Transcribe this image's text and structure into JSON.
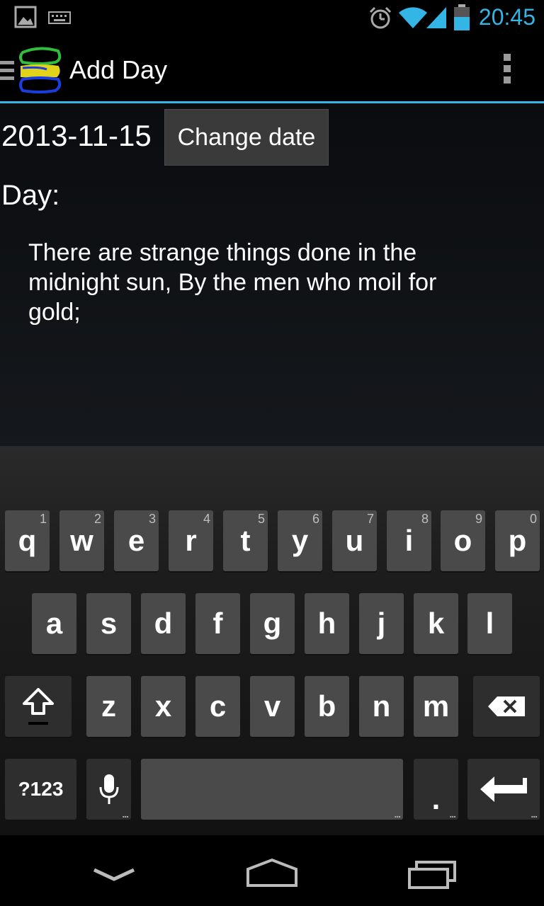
{
  "status_bar": {
    "time": "20:45",
    "icons": [
      "image-icon",
      "keyboard-icon",
      "alarm-icon",
      "wifi-icon",
      "signal-icon",
      "battery-icon"
    ],
    "accent": "#33b5e5"
  },
  "action_bar": {
    "title": "Add Day",
    "app_icon": "app-logo-icon",
    "menu_icon": "drawer-icon",
    "overflow_icon": "overflow-menu-icon"
  },
  "form": {
    "date": "2013-11-15",
    "change_date_label": "Change date",
    "day_label": "Day:",
    "day_text": "There are strange things done in the midnight sun, By the men who moil for gold;"
  },
  "keyboard": {
    "row1": [
      {
        "key": "q",
        "hint": "1"
      },
      {
        "key": "w",
        "hint": "2"
      },
      {
        "key": "e",
        "hint": "3"
      },
      {
        "key": "r",
        "hint": "4"
      },
      {
        "key": "t",
        "hint": "5"
      },
      {
        "key": "y",
        "hint": "6"
      },
      {
        "key": "u",
        "hint": "7"
      },
      {
        "key": "i",
        "hint": "8"
      },
      {
        "key": "o",
        "hint": "9"
      },
      {
        "key": "p",
        "hint": "0"
      }
    ],
    "row2": [
      "a",
      "s",
      "d",
      "f",
      "g",
      "h",
      "j",
      "k",
      "l"
    ],
    "row3": [
      "z",
      "x",
      "c",
      "v",
      "b",
      "n",
      "m"
    ],
    "symbols_label": "?123",
    "period_label": ".",
    "shift_icon": "shift-icon",
    "backspace_icon": "backspace-icon",
    "mic_icon": "microphone-icon",
    "enter_icon": "enter-icon"
  },
  "nav_bar": {
    "icons": [
      "back-icon",
      "home-icon",
      "recents-icon"
    ]
  }
}
